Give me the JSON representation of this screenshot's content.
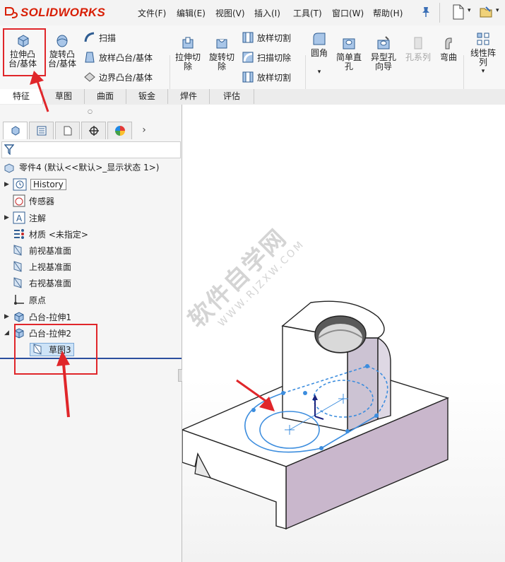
{
  "app": {
    "name": "SOLIDWORKS"
  },
  "menu": [
    "文件(F)",
    "编辑(E)",
    "视图(V)",
    "插入(I)",
    "工具(T)",
    "窗口(W)",
    "帮助(H)"
  ],
  "ribbon": {
    "extrude_boss": [
      "拉伸凸",
      "台/基体"
    ],
    "revolve_boss": [
      "旋转凸",
      "台/基体"
    ],
    "sweep": "扫描",
    "loft_boss": "放样凸台/基体",
    "boundary_boss": "边界凸台/基体",
    "extrude_cut": [
      "拉伸切",
      "除"
    ],
    "revolve_cut": [
      "旋转切",
      "除"
    ],
    "loft_cut": "放样切割",
    "sweep_cut": "扫描切除",
    "loft_cut_2": "放样切割",
    "fillet": "圆角",
    "simple_hole": [
      "简单直",
      "孔"
    ],
    "hole_wizard": [
      "异型孔",
      "向导"
    ],
    "hole_series": "孔系列",
    "flex": "弯曲",
    "linear_pattern": [
      "线性阵",
      "列"
    ]
  },
  "tabs": [
    "特征",
    "草图",
    "曲面",
    "钣金",
    "焊件",
    "评估"
  ],
  "tree": {
    "root": "零件4 (默认<<默认>_显示状态 1>)",
    "items": [
      {
        "label": "History",
        "arrow": "▶"
      },
      {
        "label": "传感器",
        "arrow": ""
      },
      {
        "label": "注解",
        "arrow": "▶"
      },
      {
        "label": "材质 <未指定>",
        "arrow": ""
      },
      {
        "label": "前视基准面",
        "arrow": ""
      },
      {
        "label": "上视基准面",
        "arrow": ""
      },
      {
        "label": "右视基准面",
        "arrow": ""
      },
      {
        "label": "原点",
        "arrow": ""
      },
      {
        "label": "凸台-拉伸1",
        "arrow": "▶"
      },
      {
        "label": "凸台-拉伸2",
        "arrow": "◢"
      },
      {
        "label": "草图3",
        "arrow": ""
      }
    ]
  },
  "watermark": {
    "line1": "软件自学网",
    "line2": "WWW.RJZXW.COM"
  },
  "colors": {
    "accent_red": "#e0262a",
    "sketch_blue": "#3c8dde",
    "body_side": "#c9b7cc"
  }
}
